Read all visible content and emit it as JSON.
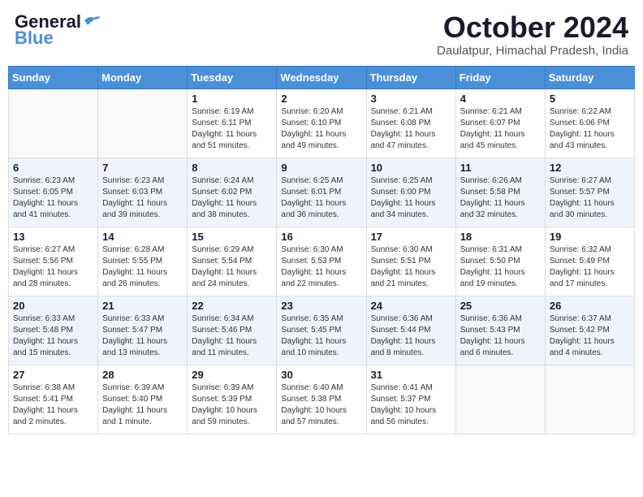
{
  "header": {
    "logo_general": "General",
    "logo_blue": "Blue",
    "month_title": "October 2024",
    "location": "Daulatpur, Himachal Pradesh, India"
  },
  "days_of_week": [
    "Sunday",
    "Monday",
    "Tuesday",
    "Wednesday",
    "Thursday",
    "Friday",
    "Saturday"
  ],
  "weeks": [
    [
      {
        "day": "",
        "sunrise": "",
        "sunset": "",
        "daylight": ""
      },
      {
        "day": "",
        "sunrise": "",
        "sunset": "",
        "daylight": ""
      },
      {
        "day": "1",
        "sunrise": "Sunrise: 6:19 AM",
        "sunset": "Sunset: 6:11 PM",
        "daylight": "Daylight: 11 hours and 51 minutes."
      },
      {
        "day": "2",
        "sunrise": "Sunrise: 6:20 AM",
        "sunset": "Sunset: 6:10 PM",
        "daylight": "Daylight: 11 hours and 49 minutes."
      },
      {
        "day": "3",
        "sunrise": "Sunrise: 6:21 AM",
        "sunset": "Sunset: 6:08 PM",
        "daylight": "Daylight: 11 hours and 47 minutes."
      },
      {
        "day": "4",
        "sunrise": "Sunrise: 6:21 AM",
        "sunset": "Sunset: 6:07 PM",
        "daylight": "Daylight: 11 hours and 45 minutes."
      },
      {
        "day": "5",
        "sunrise": "Sunrise: 6:22 AM",
        "sunset": "Sunset: 6:06 PM",
        "daylight": "Daylight: 11 hours and 43 minutes."
      }
    ],
    [
      {
        "day": "6",
        "sunrise": "Sunrise: 6:23 AM",
        "sunset": "Sunset: 6:05 PM",
        "daylight": "Daylight: 11 hours and 41 minutes."
      },
      {
        "day": "7",
        "sunrise": "Sunrise: 6:23 AM",
        "sunset": "Sunset: 6:03 PM",
        "daylight": "Daylight: 11 hours and 39 minutes."
      },
      {
        "day": "8",
        "sunrise": "Sunrise: 6:24 AM",
        "sunset": "Sunset: 6:02 PM",
        "daylight": "Daylight: 11 hours and 38 minutes."
      },
      {
        "day": "9",
        "sunrise": "Sunrise: 6:25 AM",
        "sunset": "Sunset: 6:01 PM",
        "daylight": "Daylight: 11 hours and 36 minutes."
      },
      {
        "day": "10",
        "sunrise": "Sunrise: 6:25 AM",
        "sunset": "Sunset: 6:00 PM",
        "daylight": "Daylight: 11 hours and 34 minutes."
      },
      {
        "day": "11",
        "sunrise": "Sunrise: 6:26 AM",
        "sunset": "Sunset: 5:58 PM",
        "daylight": "Daylight: 11 hours and 32 minutes."
      },
      {
        "day": "12",
        "sunrise": "Sunrise: 6:27 AM",
        "sunset": "Sunset: 5:57 PM",
        "daylight": "Daylight: 11 hours and 30 minutes."
      }
    ],
    [
      {
        "day": "13",
        "sunrise": "Sunrise: 6:27 AM",
        "sunset": "Sunset: 5:56 PM",
        "daylight": "Daylight: 11 hours and 28 minutes."
      },
      {
        "day": "14",
        "sunrise": "Sunrise: 6:28 AM",
        "sunset": "Sunset: 5:55 PM",
        "daylight": "Daylight: 11 hours and 26 minutes."
      },
      {
        "day": "15",
        "sunrise": "Sunrise: 6:29 AM",
        "sunset": "Sunset: 5:54 PM",
        "daylight": "Daylight: 11 hours and 24 minutes."
      },
      {
        "day": "16",
        "sunrise": "Sunrise: 6:30 AM",
        "sunset": "Sunset: 5:53 PM",
        "daylight": "Daylight: 11 hours and 22 minutes."
      },
      {
        "day": "17",
        "sunrise": "Sunrise: 6:30 AM",
        "sunset": "Sunset: 5:51 PM",
        "daylight": "Daylight: 11 hours and 21 minutes."
      },
      {
        "day": "18",
        "sunrise": "Sunrise: 6:31 AM",
        "sunset": "Sunset: 5:50 PM",
        "daylight": "Daylight: 11 hours and 19 minutes."
      },
      {
        "day": "19",
        "sunrise": "Sunrise: 6:32 AM",
        "sunset": "Sunset: 5:49 PM",
        "daylight": "Daylight: 11 hours and 17 minutes."
      }
    ],
    [
      {
        "day": "20",
        "sunrise": "Sunrise: 6:33 AM",
        "sunset": "Sunset: 5:48 PM",
        "daylight": "Daylight: 11 hours and 15 minutes."
      },
      {
        "day": "21",
        "sunrise": "Sunrise: 6:33 AM",
        "sunset": "Sunset: 5:47 PM",
        "daylight": "Daylight: 11 hours and 13 minutes."
      },
      {
        "day": "22",
        "sunrise": "Sunrise: 6:34 AM",
        "sunset": "Sunset: 5:46 PM",
        "daylight": "Daylight: 11 hours and 11 minutes."
      },
      {
        "day": "23",
        "sunrise": "Sunrise: 6:35 AM",
        "sunset": "Sunset: 5:45 PM",
        "daylight": "Daylight: 11 hours and 10 minutes."
      },
      {
        "day": "24",
        "sunrise": "Sunrise: 6:36 AM",
        "sunset": "Sunset: 5:44 PM",
        "daylight": "Daylight: 11 hours and 8 minutes."
      },
      {
        "day": "25",
        "sunrise": "Sunrise: 6:36 AM",
        "sunset": "Sunset: 5:43 PM",
        "daylight": "Daylight: 11 hours and 6 minutes."
      },
      {
        "day": "26",
        "sunrise": "Sunrise: 6:37 AM",
        "sunset": "Sunset: 5:42 PM",
        "daylight": "Daylight: 11 hours and 4 minutes."
      }
    ],
    [
      {
        "day": "27",
        "sunrise": "Sunrise: 6:38 AM",
        "sunset": "Sunset: 5:41 PM",
        "daylight": "Daylight: 11 hours and 2 minutes."
      },
      {
        "day": "28",
        "sunrise": "Sunrise: 6:39 AM",
        "sunset": "Sunset: 5:40 PM",
        "daylight": "Daylight: 11 hours and 1 minute."
      },
      {
        "day": "29",
        "sunrise": "Sunrise: 6:39 AM",
        "sunset": "Sunset: 5:39 PM",
        "daylight": "Daylight: 10 hours and 59 minutes."
      },
      {
        "day": "30",
        "sunrise": "Sunrise: 6:40 AM",
        "sunset": "Sunset: 5:38 PM",
        "daylight": "Daylight: 10 hours and 57 minutes."
      },
      {
        "day": "31",
        "sunrise": "Sunrise: 6:41 AM",
        "sunset": "Sunset: 5:37 PM",
        "daylight": "Daylight: 10 hours and 56 minutes."
      },
      {
        "day": "",
        "sunrise": "",
        "sunset": "",
        "daylight": ""
      },
      {
        "day": "",
        "sunrise": "",
        "sunset": "",
        "daylight": ""
      }
    ]
  ]
}
